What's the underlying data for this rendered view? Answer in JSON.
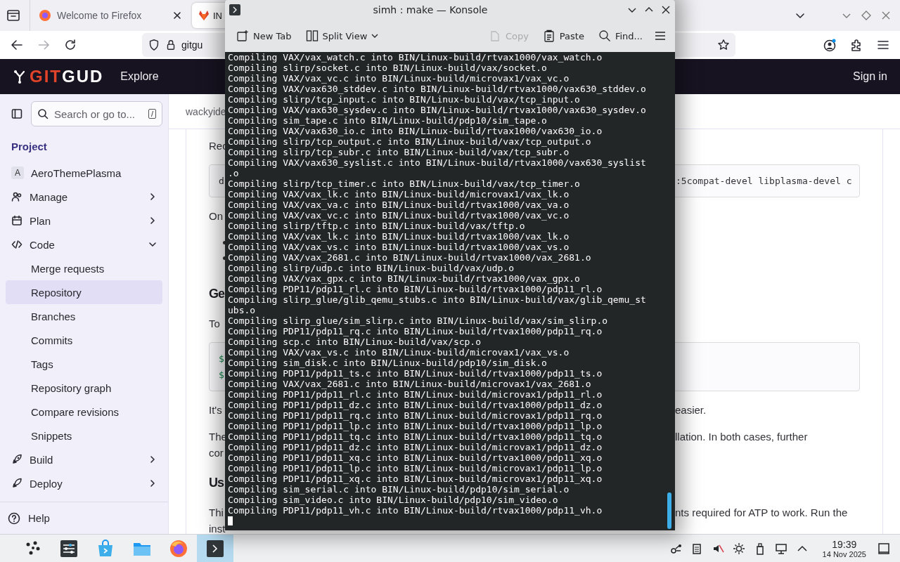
{
  "browser": {
    "tabs": [
      {
        "title": "Welcome to Firefox",
        "selected": false
      },
      {
        "title": "IN",
        "selected": true
      }
    ],
    "address": "gitgu",
    "site": {
      "logo_part_1": "GIT",
      "logo_part_2": "GUD",
      "nav_link": "Explore",
      "sign_in": "Sign in"
    },
    "sidebar": {
      "search_placeholder": "Search or go to...",
      "shortcut_key": "/",
      "section_title": "Project",
      "items": [
        {
          "kind": "project",
          "avatar": "A",
          "label": "AeroThemePlasma"
        },
        {
          "kind": "group",
          "label": "Manage",
          "expanded": false
        },
        {
          "kind": "group",
          "label": "Plan",
          "expanded": false
        },
        {
          "kind": "group",
          "label": "Code",
          "expanded": true,
          "children": [
            {
              "label": "Merge requests",
              "selected": false
            },
            {
              "label": "Repository",
              "selected": true
            },
            {
              "label": "Branches",
              "selected": false
            },
            {
              "label": "Commits",
              "selected": false
            },
            {
              "label": "Tags",
              "selected": false
            },
            {
              "label": "Repository graph",
              "selected": false
            },
            {
              "label": "Compare revisions",
              "selected": false
            },
            {
              "label": "Snippets",
              "selected": false
            }
          ]
        },
        {
          "kind": "group",
          "label": "Build",
          "expanded": false
        },
        {
          "kind": "group",
          "label": "Deploy",
          "expanded": false
        }
      ],
      "help": "Help"
    },
    "breadcrumb": "wackyide",
    "content": [
      {
        "kind": "paragraph",
        "lines": [
          {
            "left": "Rec"
          }
        ]
      },
      {
        "kind": "code",
        "lines": [
          {
            "left": "d",
            "right": ":5compat-devel libplasma-devel c"
          }
        ]
      },
      {
        "kind": "paragraph",
        "lines": [
          {
            "left": "On"
          }
        ]
      },
      {
        "kind": "bullet"
      },
      {
        "kind": "bullet"
      },
      {
        "kind": "heading",
        "lines": [
          {
            "left": "Ge"
          }
        ]
      },
      {
        "kind": "paragraph",
        "lines": [
          {
            "left": "To"
          }
        ]
      },
      {
        "kind": "shell",
        "lines": [
          {
            "left": "$"
          },
          {
            "left": "$"
          }
        ]
      },
      {
        "kind": "paragraph",
        "lines": [
          {
            "left": "It's",
            "right": "easier."
          }
        ]
      },
      {
        "kind": "paragraph",
        "lines": [
          {
            "left": "The",
            "right": "llation. In both cases, further"
          },
          {
            "left": "cor"
          }
        ]
      },
      {
        "kind": "heading",
        "lines": [
          {
            "left": "Us"
          }
        ]
      },
      {
        "kind": "paragraph",
        "lines": [
          {
            "left": "Thi",
            "right": "nts required for ATP to work. Run the"
          },
          {
            "left": "inst"
          }
        ]
      }
    ]
  },
  "konsole": {
    "title": "simh : make — Konsole",
    "toolbar": [
      {
        "label": "New Tab",
        "disabled": false
      },
      {
        "label": "Split View",
        "disabled": false
      },
      {
        "label": "Copy",
        "disabled": true
      },
      {
        "label": "Paste",
        "disabled": false
      },
      {
        "label": "Find...",
        "disabled": false
      }
    ],
    "lines": [
      "Compiling VAX/vax_watch.c into BIN/Linux-build/rtvax1000/vax_watch.o",
      "Compiling slirp/socket.c into BIN/Linux-build/vax/socket.o",
      "Compiling VAX/vax_vc.c into BIN/Linux-build/microvax1/vax_vc.o",
      "Compiling VAX/vax630_stddev.c into BIN/Linux-build/rtvax1000/vax630_stddev.o",
      "Compiling slirp/tcp_input.c into BIN/Linux-build/vax/tcp_input.o",
      "Compiling VAX/vax630_sysdev.c into BIN/Linux-build/rtvax1000/vax630_sysdev.o",
      "Compiling sim_tape.c into BIN/Linux-build/pdp10/sim_tape.o",
      "Compiling VAX/vax630_io.c into BIN/Linux-build/rtvax1000/vax630_io.o",
      "Compiling slirp/tcp_output.c into BIN/Linux-build/vax/tcp_output.o",
      "Compiling slirp/tcp_subr.c into BIN/Linux-build/vax/tcp_subr.o",
      "Compiling VAX/vax630_syslist.c into BIN/Linux-build/rtvax1000/vax630_syslist",
      ".o",
      "Compiling slirp/tcp_timer.c into BIN/Linux-build/vax/tcp_timer.o",
      "Compiling VAX/vax_lk.c into BIN/Linux-build/microvax1/vax_lk.o",
      "Compiling VAX/vax_va.c into BIN/Linux-build/rtvax1000/vax_va.o",
      "Compiling VAX/vax_vc.c into BIN/Linux-build/rtvax1000/vax_vc.o",
      "Compiling slirp/tftp.c into BIN/Linux-build/vax/tftp.o",
      "Compiling VAX/vax_lk.c into BIN/Linux-build/rtvax1000/vax_lk.o",
      "Compiling VAX/vax_vs.c into BIN/Linux-build/rtvax1000/vax_vs.o",
      "Compiling VAX/vax_2681.c into BIN/Linux-build/rtvax1000/vax_2681.o",
      "Compiling slirp/udp.c into BIN/Linux-build/vax/udp.o",
      "Compiling VAX/vax_gpx.c into BIN/Linux-build/rtvax1000/vax_gpx.o",
      "Compiling PDP11/pdp11_rl.c into BIN/Linux-build/rtvax1000/pdp11_rl.o",
      "Compiling slirp_glue/glib_qemu_stubs.c into BIN/Linux-build/vax/glib_qemu_st",
      "ubs.o",
      "Compiling slirp_glue/sim_slirp.c into BIN/Linux-build/vax/sim_slirp.o",
      "Compiling PDP11/pdp11_rq.c into BIN/Linux-build/rtvax1000/pdp11_rq.o",
      "Compiling scp.c into BIN/Linux-build/vax/scp.o",
      "Compiling VAX/vax_vs.c into BIN/Linux-build/microvax1/vax_vs.o",
      "Compiling sim_disk.c into BIN/Linux-build/pdp10/sim_disk.o",
      "Compiling PDP11/pdp11_ts.c into BIN/Linux-build/rtvax1000/pdp11_ts.o",
      "Compiling VAX/vax_2681.c into BIN/Linux-build/microvax1/vax_2681.o",
      "Compiling PDP11/pdp11_rl.c into BIN/Linux-build/microvax1/pdp11_rl.o",
      "Compiling PDP11/pdp11_dz.c into BIN/Linux-build/rtvax1000/pdp11_dz.o",
      "Compiling PDP11/pdp11_rq.c into BIN/Linux-build/microvax1/pdp11_rq.o",
      "Compiling PDP11/pdp11_lp.c into BIN/Linux-build/rtvax1000/pdp11_lp.o",
      "Compiling PDP11/pdp11_tq.c into BIN/Linux-build/rtvax1000/pdp11_tq.o",
      "Compiling PDP11/pdp11_dz.c into BIN/Linux-build/microvax1/pdp11_dz.o",
      "Compiling PDP11/pdp11_xq.c into BIN/Linux-build/rtvax1000/pdp11_xq.o",
      "Compiling PDP11/pdp11_lp.c into BIN/Linux-build/microvax1/pdp11_lp.o",
      "Compiling PDP11/pdp11_xq.c into BIN/Linux-build/microvax1/pdp11_xq.o",
      "Compiling sim_serial.c into BIN/Linux-build/pdp10/sim_serial.o",
      "Compiling sim_video.c into BIN/Linux-build/pdp10/sim_video.o",
      "Compiling PDP11/pdp11_vh.c into BIN/Linux-build/rtvax1000/pdp11_vh.o"
    ]
  },
  "taskbar": {
    "tasks": [
      {
        "selected": false
      },
      {
        "selected": false
      },
      {
        "selected": false
      },
      {
        "selected": false
      },
      {
        "selected": false
      },
      {
        "selected": true
      }
    ],
    "clock": {
      "time": "19:39",
      "date": "14 Nov 2025"
    }
  }
}
